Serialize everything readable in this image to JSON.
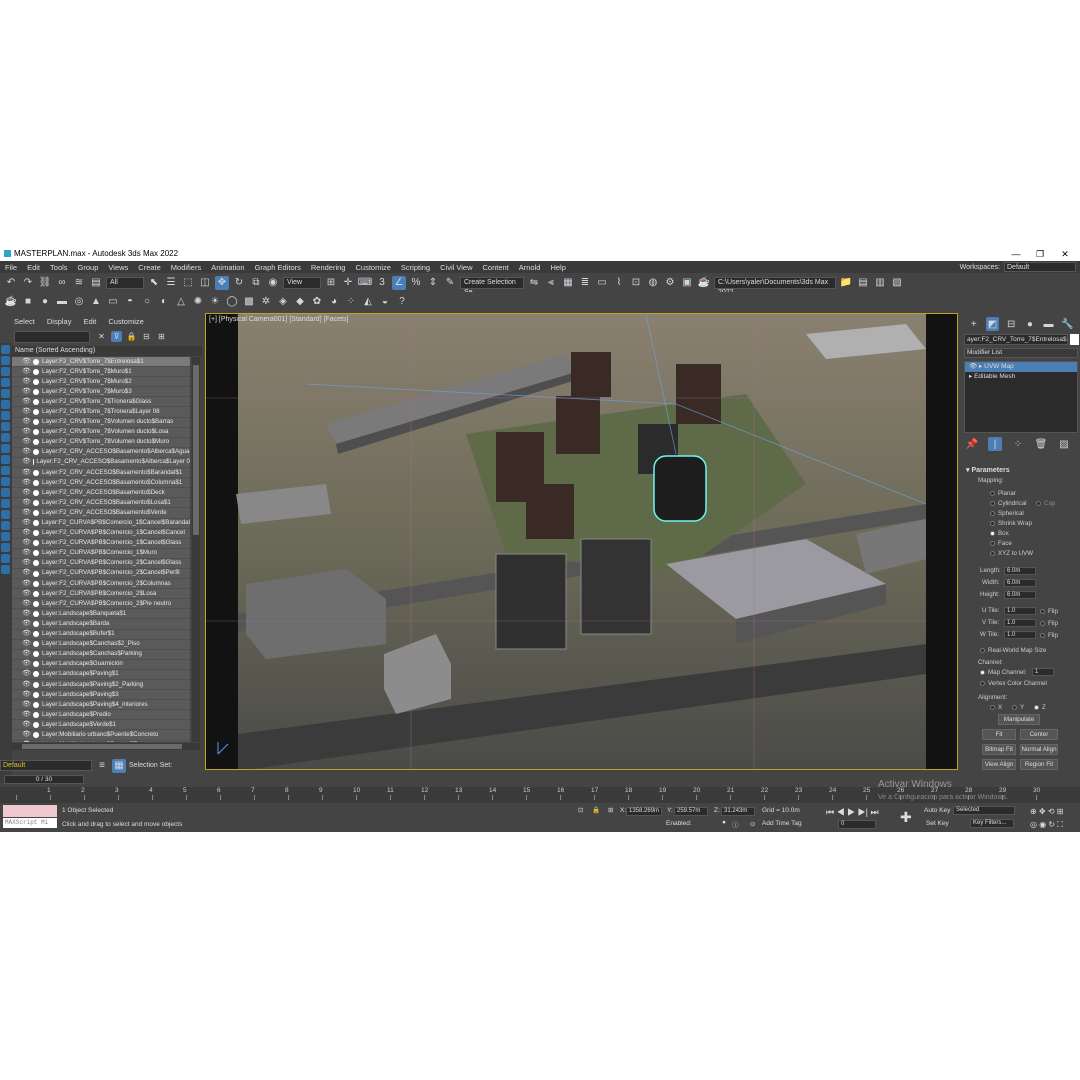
{
  "window": {
    "title": "MASTERPLAN.max - Autodesk 3ds Max 2022",
    "controls": [
      "—",
      "❐",
      "✕"
    ]
  },
  "menu": [
    "File",
    "Edit",
    "Tools",
    "Group",
    "Views",
    "Create",
    "Modifiers",
    "Animation",
    "Graph Editors",
    "Rendering",
    "Customize",
    "Scripting",
    "Civil View",
    "Content",
    "Arnold",
    "Help"
  ],
  "workspaces": {
    "label": "Workspaces:",
    "value": "Default"
  },
  "toolbar": {
    "filter": "All",
    "ref_coord": "View",
    "selection_set": "Create Selection Se",
    "project_path": "C:\\Users\\yaler\\Documents\\3ds Max 2022"
  },
  "explorer": {
    "menu": [
      "Select",
      "Display",
      "Edit",
      "Customize"
    ],
    "header": "Name (Sorted Ascending)",
    "rows": [
      "Layer:F2_CRV$Torre_7$Entrelosa$1",
      "Layer:F2_CRV$Torre_7$Muro$1",
      "Layer:F2_CRV$Torre_7$Muro$2",
      "Layer:F2_CRV$Torre_7$Muro$3",
      "Layer:F2_CRV$Torre_7$Tronera$Glass",
      "Layer:F2_CRV$Torre_7$Tronera$Layer 08",
      "Layer:F2_CRV$Torre_7$Volumen ducto$Barras",
      "Layer:F2_CRV$Torre_7$Volumen ducto$Losa",
      "Layer:F2_CRV$Torre_7$Volumen ducto$Muro",
      "Layer:F2_CRV_ACCESO$Basamento$Alberca$Agua",
      "Layer:F2_CRV_ACCESO$Basamento$Alberca$Layer 0",
      "Layer:F2_CRV_ACCESO$Basamento$Barandal$1",
      "Layer:F2_CRV_ACCESO$Basamento$Columna$1",
      "Layer:F2_CRV_ACCESO$Basamento$Deck",
      "Layer:F2_CRV_ACCESO$Basamento$Losa$1",
      "Layer:F2_CRV_ACCESO$Basamento$Verde",
      "Layer:F2_CURVA$PB$Comercio_1$Cancel$Barandal",
      "Layer:F2_CURVA$PB$Comercio_1$Cancel$Cancel",
      "Layer:F2_CURVA$PB$Comercio_1$Cancel$Glass",
      "Layer:F2_CURVA$PB$Comercio_1$Muro",
      "Layer:F2_CURVA$PB$Comercio_2$Cancel$Glass",
      "Layer:F2_CURVA$PB$Comercio_2$Cancel$Perfil",
      "Layer:F2_CURVA$PB$Comercio_2$Columnas",
      "Layer:F2_CURVA$PB$Comercio_2$Losa",
      "Layer:F2_CURVA$PB$Comercio_2$Pie neutro",
      "Layer:Landscape$Banqueta$1",
      "Layer:Landscape$Barda",
      "Layer:Landscape$Bufer$1",
      "Layer:Landscape$Canchas$2_Piso",
      "Layer:Landscape$Canchas$Parking",
      "Layer:Landscape$Guarnición",
      "Layer:Landscape$Paving$1",
      "Layer:Landscape$Paving$2_Parking",
      "Layer:Landscape$Paving$3",
      "Layer:Landscape$Paving$4_interiores",
      "Layer:Landscape$Predio",
      "Layer:Landscape$Verde$1",
      "Layer:Mobiliario urbano$Puente$Concreto",
      "Layer:Mobiliario urbano$Puente$Estructura"
    ],
    "layer": "Default",
    "selection_set_label": "Selection Set:"
  },
  "viewport": {
    "label": "[+] [Physical Camera001] [Standard] [Facets]"
  },
  "command_panel": {
    "object_name": "ayer:F2_CRV_Torre_7$Entrelosa$1",
    "modifier_list": "Modifier List",
    "stack": [
      "UVW Map",
      "Editable Mesh"
    ],
    "params_title": "Parameters",
    "mapping_label": "Mapping:",
    "mapping_options": [
      "Planar",
      "Cylindrical",
      "Spherical",
      "Shrink Wrap",
      "Box",
      "Face",
      "XYZ to UVW"
    ],
    "mapping_selected": "Box",
    "cap_label": "Cap",
    "length": {
      "label": "Length:",
      "value": "6.0m"
    },
    "width": {
      "label": "Width:",
      "value": "6.0m"
    },
    "height": {
      "label": "Height:",
      "value": "6.0m"
    },
    "u_tile": {
      "label": "U Tile:",
      "value": "1.0"
    },
    "v_tile": {
      "label": "V Tile:",
      "value": "1.0"
    },
    "w_tile": {
      "label": "W Tile:",
      "value": "1.0"
    },
    "flip": "Flip",
    "real_world": "Real-World Map Size",
    "channel_label": "Channel:",
    "map_channel": {
      "label": "Map Channel:",
      "value": "1"
    },
    "vertex_color": "Vertex Color Channel",
    "alignment_label": "Alignment:",
    "axes": [
      "X",
      "Y",
      "Z"
    ],
    "buttons": [
      "Manipulate",
      "Fit",
      "Center",
      "Bitmap Fit",
      "Normal Align",
      "View Align",
      "Region Fit"
    ]
  },
  "timeline": {
    "frame": "0 / 30",
    "ticks": [
      "0",
      "1",
      "2",
      "3",
      "4",
      "5",
      "6",
      "7",
      "8",
      "9",
      "10",
      "11",
      "12",
      "13",
      "14",
      "15",
      "16",
      "17",
      "18",
      "19",
      "20",
      "21",
      "22",
      "23",
      "24",
      "25",
      "26",
      "27",
      "28",
      "29",
      "30"
    ]
  },
  "status": {
    "maxscript": "MAXScript Mi",
    "selected": "1 Object Selected",
    "prompt": "Click and drag to select and move objects",
    "x": "1358.269m",
    "y": "259.57m",
    "z": "31.243m",
    "grid": "Grid = 10.0m",
    "enabled": "Enabled:",
    "add_time_tag": "Add Time Tag",
    "auto_key": "Auto Key",
    "selected_mode": "Selected",
    "set_key": "Set Key",
    "key_filters": "Key Filters...",
    "frame_field": "0"
  },
  "watermark": {
    "line1": "Activar Windows",
    "line2": "Ve a Configuración para activar Windows."
  }
}
